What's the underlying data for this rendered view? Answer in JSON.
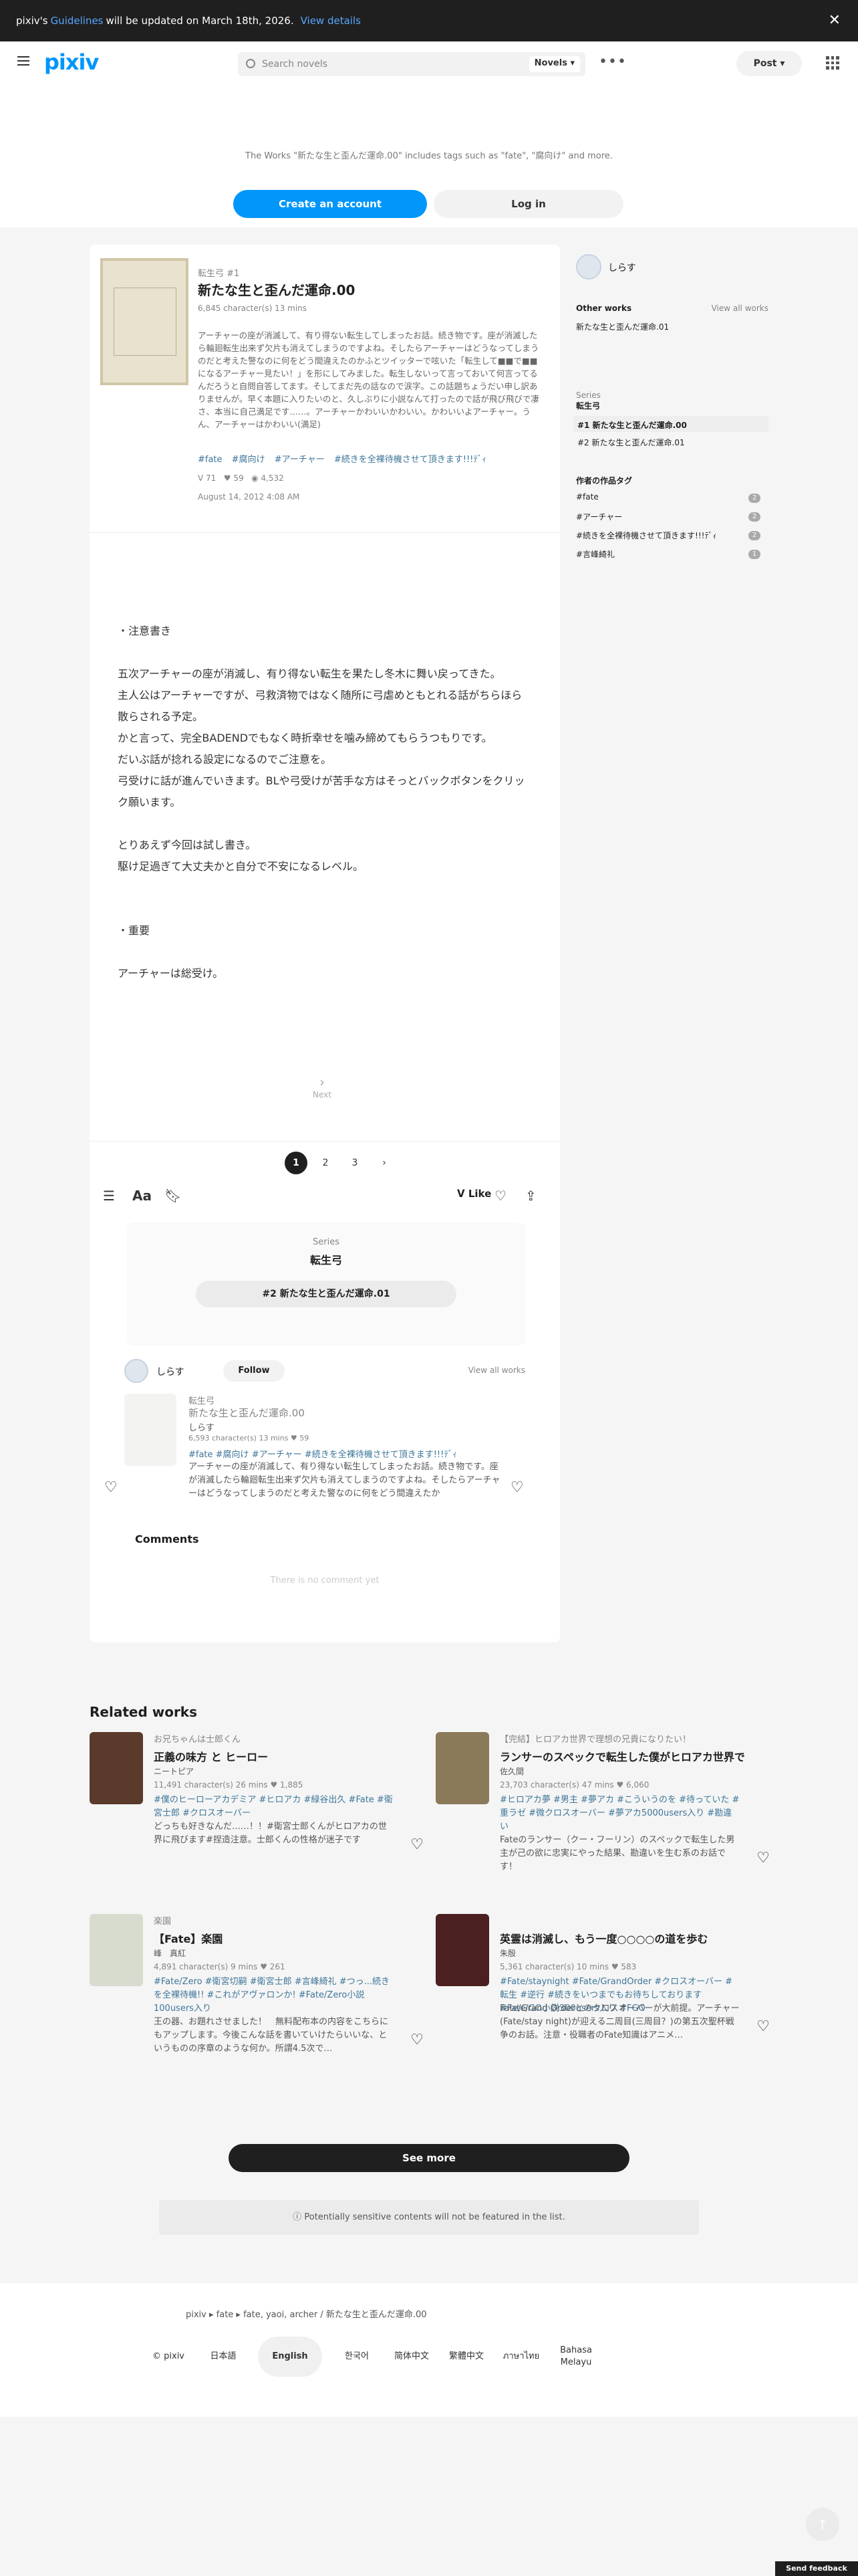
{
  "notice": {
    "prefix": "pixiv's",
    "link": "Guidelines",
    "suffix": "will be updated on March 18th, 2026.",
    "details": "View details"
  },
  "header": {
    "logo": "pixiv",
    "search_placeholder": "Search novels",
    "search_type": "Novels",
    "post": "Post"
  },
  "cta": {
    "message": "The Works \"新たな生と歪んだ運命.00\" includes tags such as \"fate\", \"腐向け\" and more.",
    "create": "Create an account",
    "login": "Log in"
  },
  "work": {
    "series": "転生弓 #1",
    "title": "新たな生と歪んだ運命.00",
    "meta": "6,845 character(s)  13 mins",
    "description": "アーチャーの座が消滅して、有り得ない転生してしまったお話。続き物です。座が消滅したら輪廻転生出来ず欠片も消えてしまうのですよね。そしたらアーチャーはどうなってしまうのだと考えた警なのに何をどう間違えたのかふとツイッターで呟いた「転生して■■で■■になるアーチャー見たい！」を形にしてみました。転生しないって言っておいて何言ってるんだろうと自問自答してます。そしてまだ先の話なので涙字。この話題ちょうだい申し訳ありませんが。早く本題に入りたいのと、久しぶりに小説なんて打ったので話が飛び飛びで凄さ、本当に自己満足です……。アーチャーかわいいかわいい。かわいいよアーチャー。うん、アーチャーはかわいい(満足)",
    "tags": [
      "#fate",
      "#腐向け",
      "#アーチャー",
      "#続きを全裸待機させて頂きます!!!ﾃﾞｨ"
    ],
    "likes": "71",
    "bookmarks": "59",
    "views": "4,532",
    "date": "August 14, 2012 4:08 AM"
  },
  "body": [
    "",
    "・注意書き",
    "",
    "五次アーチャーの座が消滅し、有り得ない転生を果たし冬木に舞い戻ってきた。",
    "主人公はアーチャーですが、弓救済物ではなく随所に弓虐めともとれる話がちらほら散らされる予定。",
    "かと言って、完全BADENDでもなく時折幸せを噛み締めてもらうつもりです。",
    "だいぶ話が捻れる設定になるのでご注意を。",
    "弓受けに話が進んでいきます。BLや弓受けが苦手な方はそっとバックボタンをクリック願います。",
    "",
    "とりあえず今回は試し書き。",
    "駆け足過ぎて大丈夫かと自分で不安になるレベル。",
    "",
    "",
    "・重要",
    "",
    "アーチャーは総受け。"
  ],
  "next_label": "Next",
  "pages": [
    "1",
    "2",
    "3"
  ],
  "toolbar": {
    "like": "Like"
  },
  "series_box": {
    "label": "Series",
    "name": "転生弓",
    "next": "#2 新たな生と歪んだ運命.01"
  },
  "author": {
    "name": "しらす",
    "follow": "Follow",
    "view_all": "View all works"
  },
  "card": {
    "series": "転生弓",
    "title": "新たな生と歪んだ運命.00",
    "author": "しらす",
    "meta": "6,593 character(s)  13 mins  ♥ 59",
    "tags": "#fate  #腐向け  #アーチャー  #続きを全裸待機させて頂きます!!!ﾃﾞｨ",
    "desc": "アーチャーの座が消滅して、有り得ない転生してしまったお話。続き物です。座が消滅したら輪廻転生出来ず欠片も消えてしまうのですよね。そしたらアーチャーはどうなってしまうのだと考えた警なのに何をどう間違えたか"
  },
  "comments": {
    "title": "Comments",
    "empty": "There is no comment yet"
  },
  "side": {
    "author": "しらす",
    "other_works": "Other works",
    "view_all": "View all works",
    "other_item": "新たな生と歪んだ運命.01",
    "series_label": "Series",
    "series_name": "転生弓",
    "series_items": [
      "#1 新たな生と歪んだ運命.00",
      "#2 新たな生と歪んだ運命.01"
    ],
    "tags_label": "作者の作品タグ",
    "tags": [
      {
        "t": "#fate",
        "n": "2"
      },
      {
        "t": "#アーチャー",
        "n": "2"
      },
      {
        "t": "#続きを全裸待機させて頂きます!!!ﾃﾞｨ",
        "n": "2"
      },
      {
        "t": "#言峰綺礼",
        "n": "1"
      }
    ]
  },
  "related": {
    "heading": "Related works",
    "items": [
      {
        "sub": "お兄ちゃんは士郎くん",
        "title": "正義の味方 と ヒーロー",
        "author": "ニートピア",
        "meta": "11,491 character(s)  26 mins  ♥ 1,885",
        "tags": "#僕のヒーローアカデミア  #ヒロアカ  #緑谷出久  #Fate  #衛宮士郎  #クロスオーバー",
        "desc": "どっちも好きなんだ……！！#衛宮士郎くんがヒロアカの世界に飛びます#捏造注意。士郎くんの性格が迷子です"
      },
      {
        "sub": "【完結】ヒロアカ世界で理想の兄貴になりたい！",
        "title": "ランサーのスペックで転生した僕がヒロアカ世界で",
        "author": "佐久間",
        "meta": "23,703 character(s)  47 mins  ♥ 6,060",
        "tags": "#ヒロアカ夢  #男主  #夢アカ  #こういうのを  #待っていた  #重ラゼ  #微クロスオーバー  #夢アカ5000users入り  #勘違い",
        "desc": "Fateのランサー（クー・フーリン）のスペックで転生した男主が己の欲に忠実にやった結果、勘違いを生む系のお話です！"
      },
      {
        "sub": "楽園",
        "title": "【Fate】楽園",
        "author": "峰　真紅",
        "meta": "4,891 character(s)  9 mins  ♥ 261",
        "tags": "#Fate/Zero  #衛宮切嗣  #衛宮士郎  #言峰綺礼  #つっ...続きを全裸待機!!  #これがアヴァロンか!  #Fate/Zero小説100users入り",
        "desc": "王の器、お題れさせました！　無料配布本の内容をこちらにもアップします。今後こんな話を書いていけたらいいな、というものの序章のような何か。所謂4.5次で…"
      },
      {
        "sub": "",
        "title": "英霊は消滅し、もう一度○○○○の道を歩む",
        "author": "朱殷",
        "meta": "5,361 character(s)  10 mins  ♥ 583",
        "tags": "#Fate/staynight  #Fate/GrandOrder  #クロスオーバー  #転生  #逆行  #続きをいつまでもお待ちしております  #Fate/GO小説300users入り  #FGO",
        "desc": "Fate/Grand Orderとのクロスオーバーが大前提。アーチャー(Fate/stay night)が迎える二周目(三周目？)の第五次聖杯戦争のお話。注意・役職者のFate知識はアニメ…"
      }
    ]
  },
  "see_more": "See more",
  "warning": "Potentially sensitive contents will not be featured in the list.",
  "footer": {
    "crumb": "pixiv  ▸  fate  ▸  fate, yaoi, archer / 新たな生と歪んだ運命.00",
    "langs": [
      "© pixiv",
      "日本語",
      "English",
      "한국어",
      "简体中文",
      "繁體中文",
      "ภาษาไทย",
      "Bahasa Melayu"
    ]
  },
  "feedback": "Send feedback"
}
